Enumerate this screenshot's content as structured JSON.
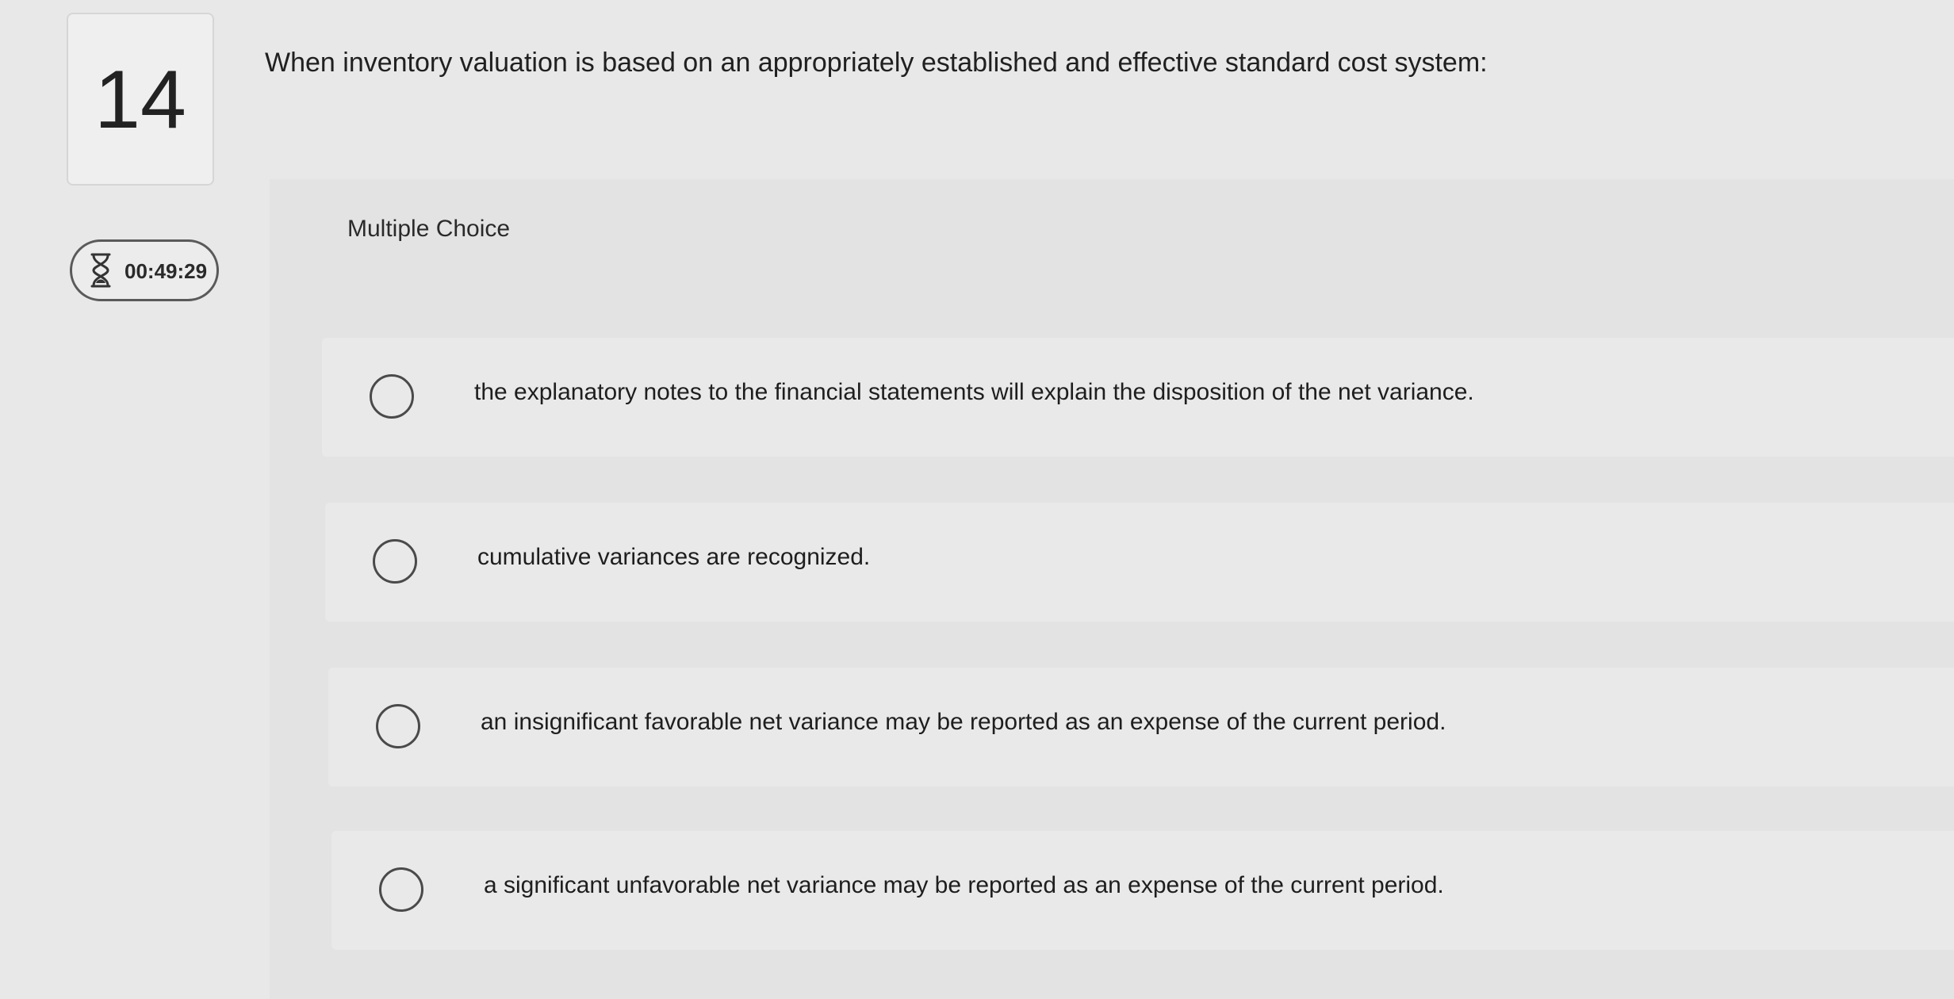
{
  "question": {
    "number": "14",
    "text": "When inventory valuation is based on an appropriately established and effective standard cost system:",
    "timer": "00:49:29",
    "type_label": "Multiple Choice"
  },
  "options": [
    {
      "label": "the explanatory notes to the financial statements will explain the disposition of the net variance."
    },
    {
      "label": "cumulative variances are recognized."
    },
    {
      "label": "an insignificant favorable net variance may be reported as an expense of the current period."
    },
    {
      "label": "a significant unfavorable net variance may be reported as an expense of the current period."
    }
  ],
  "icons": {
    "timer": "hourglass-icon",
    "option_radio": "radio-button"
  },
  "colors": {
    "background": "#e8e8e8",
    "panel": "#e3e3e3",
    "text": "#1f1f1f",
    "radio_border": "#4a4a4a"
  }
}
